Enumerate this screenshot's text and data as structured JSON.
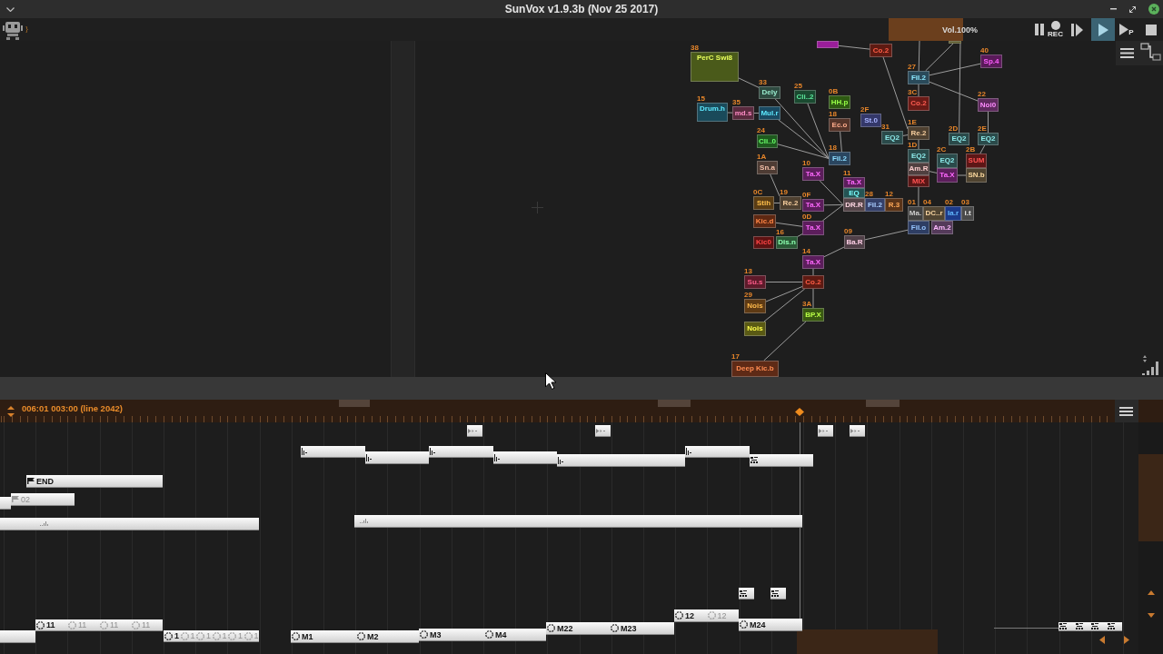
{
  "window": {
    "title": "SunVox v1.9.3b (Nov 25 2017)"
  },
  "toolbar": {
    "volume": {
      "label": "Vol.100%",
      "level": 0.52
    },
    "transport": [
      {
        "kind": "pause",
        "selected": false
      },
      {
        "kind": "record",
        "label": "REC",
        "selected": false
      },
      {
        "kind": "play_from_start",
        "selected": false
      },
      {
        "kind": "play",
        "selected": true
      },
      {
        "kind": "play_pattern",
        "label": "P",
        "selected": false
      },
      {
        "kind": "stop",
        "selected": false
      }
    ]
  },
  "modules": [
    {
      "color": "#9a1e9a"
    },
    {
      "color": "#5a5a2a"
    },
    {
      "number": "38",
      "label": "PerC Swi8",
      "color": "#4a5a1a"
    },
    {
      "label": "Co.2",
      "color": "#5e1a12"
    },
    {
      "number": "40",
      "label": "Sp.4",
      "color": "#5a1a5a"
    },
    {
      "number": "27",
      "label": "Fil.2",
      "color": "#2a4a5a"
    },
    {
      "number": "33",
      "label": "Dely",
      "color": "#2e4a40"
    },
    {
      "number": "15",
      "label": "Drum.h",
      "color": "#1a4a5a"
    },
    {
      "number": "25",
      "label": "Cli..2",
      "color": "#1a4a30"
    },
    {
      "number": "35",
      "label": "md.s",
      "color": "#5a2a3e"
    },
    {
      "label": "Mul.r",
      "color": "#1a4a62"
    },
    {
      "number": "0B",
      "label": "HH.p",
      "color": "#2e5a12"
    },
    {
      "number": "3C",
      "label": "Co.2",
      "color": "#6a1a16"
    },
    {
      "number": "22",
      "label": "Noi0",
      "color": "#5e2a5e"
    },
    {
      "number": "18",
      "label": "Ec.o",
      "color": "#55352a"
    },
    {
      "number": "2F",
      "label": "St.0",
      "color": "#34386a"
    },
    {
      "number": "24",
      "label": "Cli..0",
      "color": "#1e5a1e"
    },
    {
      "number": "31",
      "label": "EQ2",
      "color": "#2a4a4a"
    },
    {
      "number": "1E",
      "label": "Re.2",
      "color": "#4e4030"
    },
    {
      "number": "2D",
      "label": "EQ2",
      "color": "#2a4a4a"
    },
    {
      "number": "2E",
      "label": "EQ2",
      "color": "#2a4a4a"
    },
    {
      "number": "1A",
      "label": "Sn.a",
      "color": "#4e3c34"
    },
    {
      "number": "18",
      "label": "Fil.2",
      "color": "#2a4660"
    },
    {
      "number": "1D",
      "label": "EQ2",
      "color": "#2a4a4a"
    },
    {
      "number": "10",
      "label": "Ta.X",
      "color": "#5c1e5c"
    },
    {
      "label": "Am.R",
      "color": "#504040"
    },
    {
      "number": "2C",
      "label": "EQ2",
      "color": "#2a4a4a"
    },
    {
      "number": "2B",
      "label": "SUM",
      "color": "#5e1616"
    },
    {
      "number": "11",
      "label": "Ta.X",
      "color": "#5c1e5c"
    },
    {
      "label": "MIX",
      "color": "#5a1616"
    },
    {
      "label": "Ta.X",
      "color": "#5c1e5c"
    },
    {
      "label": "SN.b",
      "color": "#504430"
    },
    {
      "number": "0C",
      "label": "Stih",
      "color": "#5a3c14"
    },
    {
      "number": "19",
      "label": "Re.2",
      "color": "#4e4030"
    },
    {
      "number": "0F",
      "label": "Ta.X",
      "color": "#5c1e5c"
    },
    {
      "label": "EQ",
      "color": "#245454"
    },
    {
      "label": "DR.R",
      "color": "#544448"
    },
    {
      "number": "28",
      "label": "Fil.2",
      "color": "#34406a"
    },
    {
      "number": "12",
      "label": "R.3",
      "color": "#5a3418"
    },
    {
      "label": "Kic.d",
      "color": "#5e2812"
    },
    {
      "number": "01",
      "label": "Ma.",
      "color": "#404040"
    },
    {
      "number": "04",
      "label": "DC..r",
      "color": "#504432"
    },
    {
      "number": "02",
      "label": "Ia.r",
      "color": "#1c3a8a"
    },
    {
      "number": "03",
      "label": "i.t",
      "color": "#4a4a4a"
    },
    {
      "number": "0D",
      "label": "Ta.X",
      "color": "#5c1e5c"
    },
    {
      "label": "Fil.o",
      "color": "#2e3e64"
    },
    {
      "label": "Am.2",
      "color": "#543a5a"
    },
    {
      "label": "Kic0",
      "color": "#5e1212"
    },
    {
      "number": "16",
      "label": "Dis.n",
      "color": "#2a5a36"
    },
    {
      "number": "09",
      "label": "Ba.R",
      "color": "#504048"
    },
    {
      "number": "14",
      "label": "Ta.X",
      "color": "#5c1e5c"
    },
    {
      "number": "13",
      "label": "Su.s",
      "color": "#5e1a2a"
    },
    {
      "label": "Co.2",
      "color": "#5e1a12"
    },
    {
      "number": "29",
      "label": "Nois",
      "color": "#5e3a14"
    },
    {
      "number": "3A",
      "label": "BP.X",
      "color": "#3a5a12"
    },
    {
      "label": "Nois",
      "color": "#5a5a14"
    },
    {
      "number": "17",
      "label": "Deep Kic.b",
      "color": "#5e2a16"
    }
  ],
  "timeline": {
    "position": "006:01 003:00 (line 2042)",
    "patterns": [
      {
        "selected": false
      },
      {
        "selected": false
      },
      {
        "selected": false
      },
      {
        "selected": false
      },
      {
        "selected": false
      },
      {
        "selected": false
      },
      {
        "selected": false
      },
      {
        "selected": false
      },
      {
        "selected": false
      },
      {
        "selected": false
      },
      {
        "selected": false
      },
      {
        "labels": [
          {
            "text": "END",
            "dim": false
          }
        ],
        "selected": false
      },
      {
        "selected": false
      },
      {
        "labels": [
          {
            "text": "02",
            "dim": true
          }
        ],
        "selected": false
      },
      {
        "selected": false
      },
      {
        "selected": false
      },
      {
        "selected": false
      },
      {
        "selected": false
      },
      {
        "labels": [
          {
            "text": "11",
            "dim": false
          },
          {
            "text": "11",
            "dim": true
          },
          {
            "text": "11",
            "dim": true
          },
          {
            "text": "11",
            "dim": true
          }
        ],
        "selected": false
      },
      {
        "labels": [
          {
            "text": "12",
            "dim": false
          },
          {
            "text": "12",
            "dim": true
          }
        ],
        "selected": false
      },
      {
        "selected": false
      },
      {
        "labels": [
          {
            "text": "1",
            "dim": false
          },
          {
            "text": "1",
            "dim": true
          },
          {
            "text": "1",
            "dim": true
          },
          {
            "text": "1",
            "dim": true
          },
          {
            "text": "1",
            "dim": true
          },
          {
            "text": "1",
            "dim": true
          }
        ],
        "selected": false
      },
      {
        "labels": [
          {
            "text": "M1",
            "dim": false
          }
        ],
        "selected": false
      },
      {
        "labels": [
          {
            "text": "M2",
            "dim": false
          }
        ],
        "selected": false
      },
      {
        "labels": [
          {
            "text": "M3",
            "dim": false
          }
        ],
        "selected": false
      },
      {
        "labels": [
          {
            "text": "M4",
            "dim": false
          }
        ],
        "selected": false
      },
      {
        "labels": [
          {
            "text": "M22",
            "dim": false
          }
        ],
        "selected": false
      },
      {
        "labels": [
          {
            "text": "M23",
            "dim": false
          }
        ],
        "selected": false
      },
      {
        "labels": [
          {
            "text": "M24",
            "dim": false
          }
        ],
        "selected": false
      },
      {
        "selected": false
      }
    ]
  }
}
